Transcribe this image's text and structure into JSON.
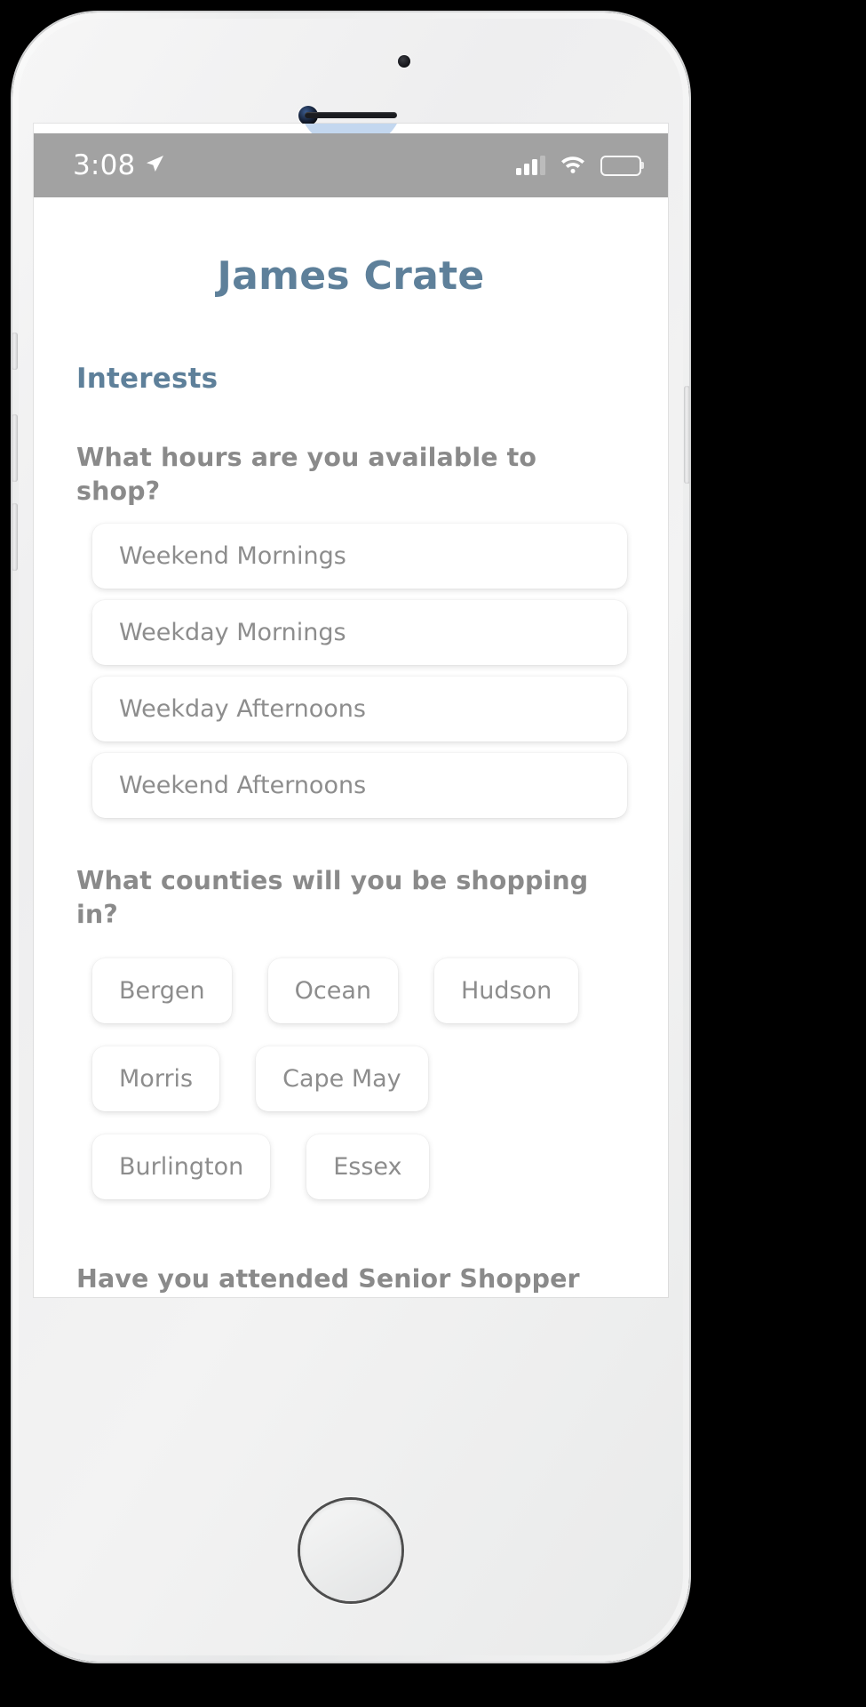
{
  "status_bar": {
    "time": "3:08",
    "location_icon": "location-arrow-icon",
    "signal_icon": "cellular-signal-icon",
    "wifi_icon": "wifi-icon",
    "battery_icon": "battery-full-icon"
  },
  "app": {
    "title": "James Crate",
    "section_heading": "Interests",
    "accent_color": "#5e809a",
    "question_color": "#8a8a8a",
    "chip_text_color": "#8d8d8d"
  },
  "questions": [
    {
      "label": "What hours are you available to shop?",
      "layout": "stacked",
      "options": [
        "Weekend Mornings",
        "Weekday Mornings",
        "Weekday Afternoons",
        "Weekend Afternoons"
      ]
    },
    {
      "label": "What counties will you be shopping in?",
      "layout": "wrapped",
      "options": [
        "Bergen",
        "Ocean",
        "Hudson",
        "Morris",
        "Cape May",
        "Burlington",
        "Essex"
      ]
    },
    {
      "label": "Have you attended Senior Shopper orientation session?",
      "layout": "none",
      "options": []
    }
  ],
  "device": {
    "home_button": "home-button",
    "earpiece": "earpiece-speaker",
    "front_camera": "front-camera",
    "proximity_sensor": "proximity-sensor"
  }
}
